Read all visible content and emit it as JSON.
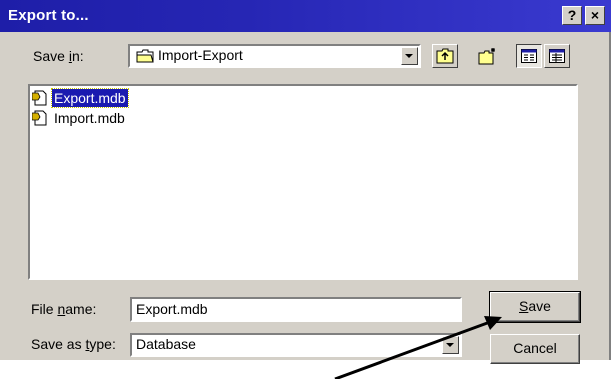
{
  "window": {
    "title": "Export to...",
    "help_button": "?",
    "close_button": "×"
  },
  "save_in": {
    "label_pre": "Save ",
    "label_u": "i",
    "label_post": "n:",
    "value": "Import-Export"
  },
  "toolbar": {
    "icons": [
      "up-one-level-icon",
      "create-new-folder-icon",
      "list-view-icon",
      "details-view-icon"
    ]
  },
  "files": [
    {
      "name": "Export.mdb",
      "selected": true
    },
    {
      "name": "Import.mdb",
      "selected": false
    }
  ],
  "file_name": {
    "label_pre": "File ",
    "label_u": "n",
    "label_post": "ame:",
    "value": "Export.mdb"
  },
  "save_as_type": {
    "label_pre": "Save as ",
    "label_u": "t",
    "label_post": "ype:",
    "value": "Database"
  },
  "buttons": {
    "save_u": "S",
    "save_rest": "ave",
    "cancel": "Cancel"
  },
  "colors": {
    "titlebar": "#2626b4",
    "face": "#d4d0c8",
    "selection": "#1a1ab0"
  }
}
